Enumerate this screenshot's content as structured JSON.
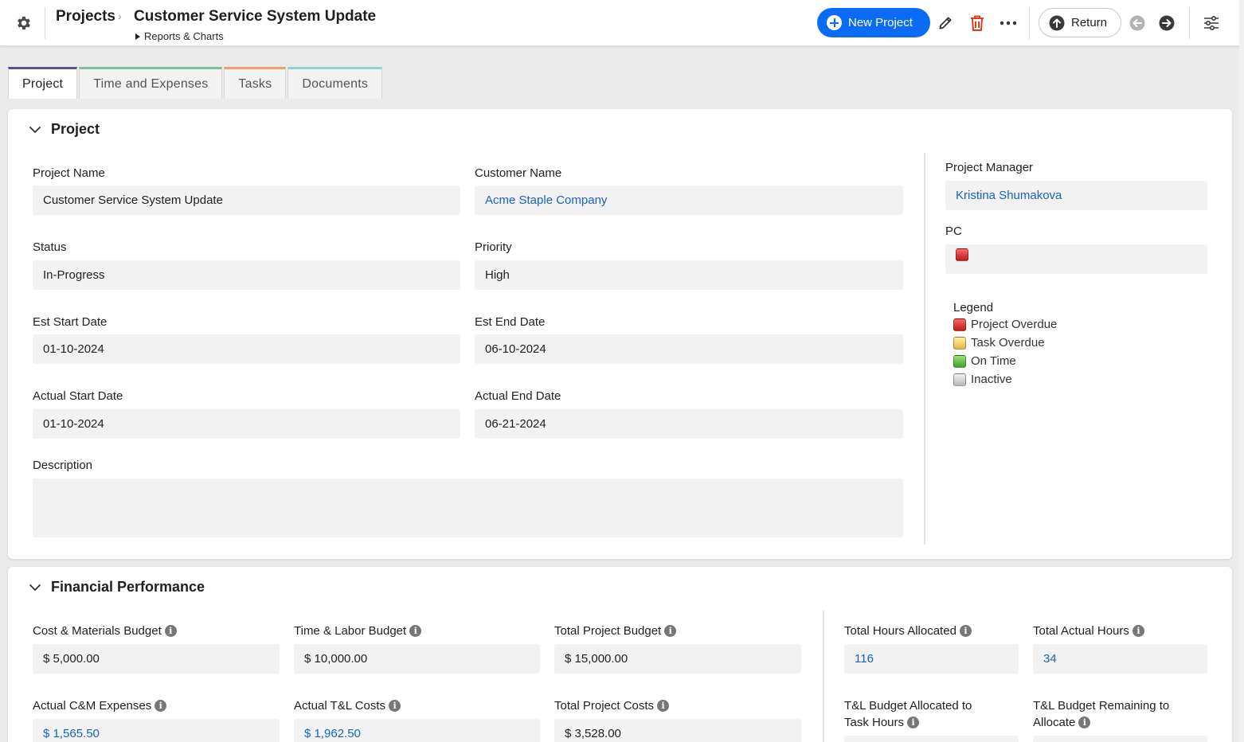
{
  "header": {
    "root_crumb": "Projects",
    "title": "Customer Service System Update",
    "sub_crumb": "Reports & Charts",
    "new_project_label": "New Project",
    "return_label": "Return"
  },
  "tabs": [
    {
      "label": "Project",
      "color": "#5b4f96",
      "active": true
    },
    {
      "label": "Time and Expenses",
      "color": "#7fbf9a",
      "active": false
    },
    {
      "label": "Tasks",
      "color": "#f0a070",
      "active": false
    },
    {
      "label": "Documents",
      "color": "#8fd0d0",
      "active": false
    }
  ],
  "project": {
    "section_title": "Project",
    "fields": {
      "project_name": {
        "label": "Project Name",
        "value": "Customer Service System Update"
      },
      "customer_name": {
        "label": "Customer Name",
        "value": "Acme Staple Company"
      },
      "status": {
        "label": "Status",
        "value": "In-Progress"
      },
      "priority": {
        "label": "Priority",
        "value": "High"
      },
      "est_start": {
        "label": "Est Start Date",
        "value": "01-10-2024"
      },
      "est_end": {
        "label": "Est End Date",
        "value": "06-10-2024"
      },
      "actual_start": {
        "label": "Actual Start Date",
        "value": "01-10-2024"
      },
      "actual_end": {
        "label": "Actual End Date",
        "value": "06-21-2024"
      },
      "description": {
        "label": "Description",
        "value": ""
      },
      "project_manager": {
        "label": "Project Manager",
        "value": "Kristina Shumakova"
      },
      "pc": {
        "label": "PC",
        "value_color": "red"
      }
    },
    "legend": {
      "title": "Legend",
      "items": [
        {
          "label": "Project Overdue",
          "color": "red"
        },
        {
          "label": "Task Overdue",
          "color": "yellow"
        },
        {
          "label": "On Time",
          "color": "green"
        },
        {
          "label": "Inactive",
          "color": "gray"
        }
      ]
    }
  },
  "financial": {
    "section_title": "Financial Performance",
    "fields": {
      "cm_budget": {
        "label": "Cost & Materials Budget",
        "value": "$ 5,000.00"
      },
      "tl_budget": {
        "label": "Time & Labor Budget",
        "value": "$ 10,000.00"
      },
      "total_budget": {
        "label": "Total Project Budget",
        "value": "$ 15,000.00"
      },
      "hours_allocated": {
        "label": "Total Hours Allocated",
        "value": "116"
      },
      "actual_hours": {
        "label": "Total Actual Hours",
        "value": "34"
      },
      "actual_cm": {
        "label": "Actual C&M Expenses",
        "value": "$ 1,565.50"
      },
      "actual_tl": {
        "label": "Actual T&L Costs",
        "value": "$ 1,962.50"
      },
      "total_costs": {
        "label": "Total Project Costs",
        "value": "$ 3,528.00"
      },
      "tl_allocated_line1": "T&L Budget Allocated to",
      "tl_allocated_line2": "Task Hours",
      "tl_remaining_line1": "T&L Budget Remaining to",
      "tl_remaining_line2": "Allocate"
    }
  },
  "colors": {
    "accent": "#0a6cf5",
    "link": "#1565c0",
    "danger": "#e03b1f"
  }
}
